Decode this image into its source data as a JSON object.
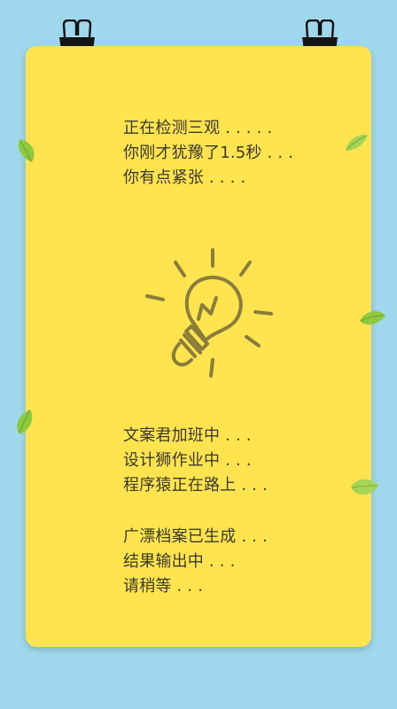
{
  "status_lines": [
    "正在检测三观 . . . . .",
    "你刚才犹豫了1.5秒 . . .",
    "你有点紧张 . . . ."
  ],
  "progress_lines": [
    "文案君加班中 . . .",
    "设计狮作业中 . . .",
    "程序猿正在路上 . . ."
  ],
  "result_lines": [
    "广漂档案已生成 . . .",
    "结果输出中 . . .",
    "请稍等 . . ."
  ],
  "icons": {
    "binder_clip": "binder-clip-icon",
    "lightbulb": "lightbulb-icon",
    "leaf": "leaf-icon"
  },
  "colors": {
    "background": "#9fd8ec",
    "card": "#ffe34f",
    "text": "#3a3a2a",
    "bulb_stroke": "#8a7d3c",
    "leaf": "#8fc940"
  }
}
